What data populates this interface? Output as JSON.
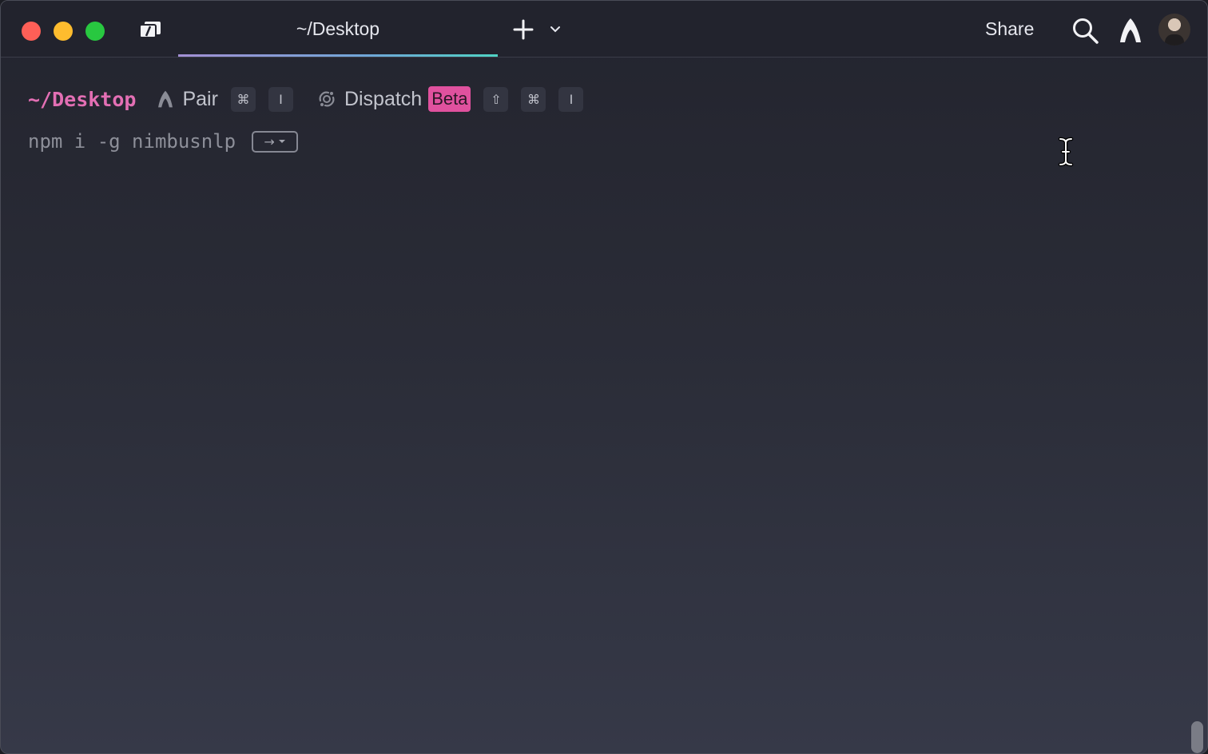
{
  "titlebar": {
    "tab_label": "~/Desktop",
    "share_label": "Share",
    "icons": {
      "sidebar": "sidebar-toggle-icon",
      "new_tab": "plus-icon",
      "tab_menu": "chevron-down-icon",
      "search": "search-icon",
      "warp": "warp-logo-icon",
      "avatar": "user-avatar"
    }
  },
  "prompt": {
    "cwd": "~/Desktop",
    "pair_label": "Pair",
    "pair_keys": [
      "⌘",
      "I"
    ],
    "dispatch_label": "Dispatch",
    "dispatch_badge": "Beta",
    "dispatch_keys": [
      "⇧",
      "⌘",
      "I"
    ]
  },
  "input": {
    "suggestion": "npm i -g nimbusnlp",
    "accept_hint_arrow": "→"
  },
  "colors": {
    "cwd": "#e36fb4",
    "beta_badge": "#e0519e",
    "close": "#fe5f57",
    "minimize": "#febc2e",
    "maximize": "#28c840"
  }
}
